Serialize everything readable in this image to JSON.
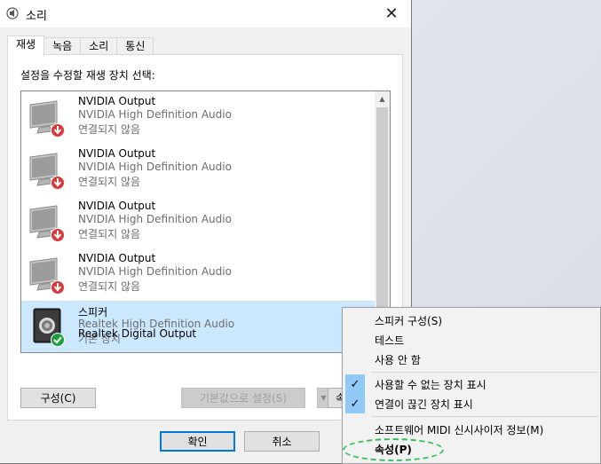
{
  "window": {
    "title": "소리",
    "close_label": "✕"
  },
  "tabs": [
    {
      "label": "재생",
      "active": true
    },
    {
      "label": "녹음",
      "active": false
    },
    {
      "label": "소리",
      "active": false
    },
    {
      "label": "통신",
      "active": false
    }
  ],
  "instruction": "설정을 수정할 재생 장치 선택:",
  "devices": [
    {
      "name": "NVIDIA Output",
      "driver": "NVIDIA High Definition Audio",
      "status": "연결되지 않음",
      "icon": "monitor-icon",
      "badge": "disconnected-arrow-icon",
      "selected": false
    },
    {
      "name": "NVIDIA Output",
      "driver": "NVIDIA High Definition Audio",
      "status": "연결되지 않음",
      "icon": "monitor-icon",
      "badge": "disconnected-arrow-icon",
      "selected": false
    },
    {
      "name": "NVIDIA Output",
      "driver": "NVIDIA High Definition Audio",
      "status": "연결되지 않음",
      "icon": "monitor-icon",
      "badge": "disconnected-arrow-icon",
      "selected": false
    },
    {
      "name": "NVIDIA Output",
      "driver": "NVIDIA High Definition Audio",
      "status": "연결되지 않음",
      "icon": "monitor-icon",
      "badge": "disconnected-arrow-icon",
      "selected": false
    },
    {
      "name": "스피커",
      "driver": "Realtek High Definition Audio",
      "status": "기본 장치",
      "icon": "speaker-icon",
      "badge": "default-check-icon",
      "selected": true
    },
    {
      "name": "Realtek Digital Output",
      "driver": "",
      "status": "",
      "icon": "",
      "badge": "",
      "selected": false
    }
  ],
  "buttons": {
    "configure": "구성(C)",
    "set_default": "기본값으로 설정(S)",
    "properties_partial": "속",
    "ok": "확인",
    "cancel": "취소"
  },
  "context_menu": {
    "items": [
      {
        "label": "스피커 구성(S)",
        "checked": false
      },
      {
        "label": "테스트",
        "checked": false
      },
      {
        "label": "사용 안 함",
        "checked": false
      },
      {
        "label": "사용할 수 없는 장치 표시",
        "checked": true
      },
      {
        "label": "연결이 끊긴 장치 표시",
        "checked": true
      },
      {
        "label": "소프트웨어 MIDI 신시사이저 정보(M)",
        "checked": false
      },
      {
        "label": "속성(P)",
        "checked": false
      }
    ]
  },
  "colors": {
    "selection": "#cce8ff",
    "menu_check_bg": "#90c8f6",
    "default_button_border": "#0078d7",
    "highlight_ring": "#35c15a"
  }
}
